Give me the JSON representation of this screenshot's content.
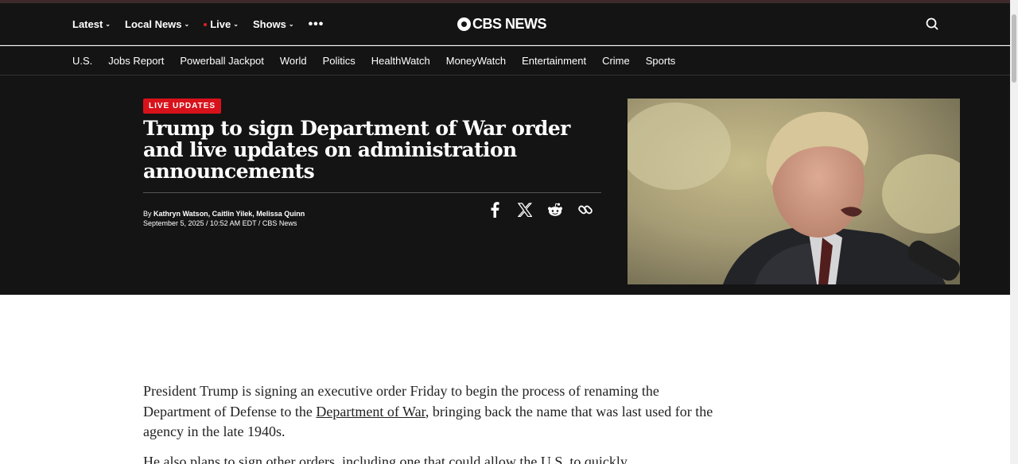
{
  "header": {
    "nav": [
      {
        "label": "Latest"
      },
      {
        "label": "Local News"
      },
      {
        "label": "Live"
      },
      {
        "label": "Shows"
      }
    ],
    "more_label": "•••",
    "logo_text": "CBS NEWS"
  },
  "subnav": [
    "U.S.",
    "Jobs Report",
    "Powerball Jackpot",
    "World",
    "Politics",
    "HealthWatch",
    "MoneyWatch",
    "Entertainment",
    "Crime",
    "Sports"
  ],
  "hero": {
    "badge": "LIVE UPDATES",
    "headline": "Trump to sign Department of War order and live updates on administration announcements",
    "byline_prefix": "By ",
    "authors": "Kathryn Watson, Caitlin Yilek, Melissa Quinn",
    "dateline": "September 5, 2025 / 10:52 AM EDT / CBS News",
    "share_icons": [
      "facebook-icon",
      "x-icon",
      "reddit-icon",
      "link-icon"
    ]
  },
  "article": {
    "p1_before": "President Trump is signing an executive order Friday to begin the process of renaming the Department of Defense to the ",
    "p1_link": "Department of War",
    "p1_after": ", bringing back the name that was last used for the agency in the late 1940s.",
    "p2": "He also plans to sign other orders, including one that could allow the U.S. to quickly"
  },
  "colors": {
    "header_bg": "#141414",
    "badge_red": "#d8121b",
    "live_dot": "#e0201b"
  }
}
